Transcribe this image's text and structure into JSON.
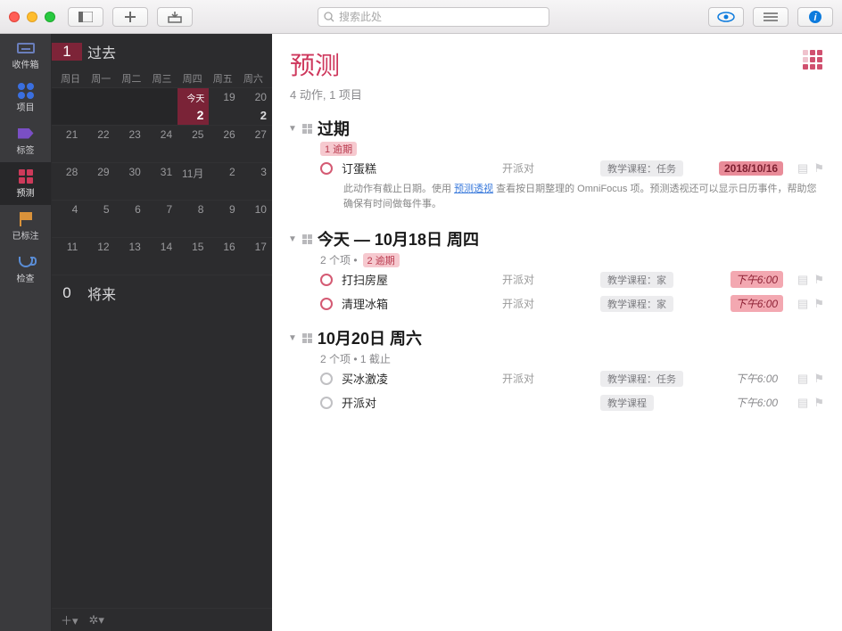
{
  "toolbar": {
    "search_placeholder": "搜索此处"
  },
  "sidebar": {
    "items": [
      {
        "label": "收件箱"
      },
      {
        "label": "项目"
      },
      {
        "label": "标签"
      },
      {
        "label": "预测"
      },
      {
        "label": "已标注"
      },
      {
        "label": "检查"
      }
    ]
  },
  "calendar": {
    "past_badge": "1",
    "past_label": "过去",
    "weekdays": [
      "周日",
      "周一",
      "周二",
      "周三",
      "周四",
      "周五",
      "周六"
    ],
    "today_label": "今天",
    "today_badge": "2",
    "days_row1": [
      "",
      "",
      "",
      "",
      "",
      "19",
      "20"
    ],
    "day20_badge": "2",
    "days_row2": [
      "21",
      "22",
      "23",
      "24",
      "25",
      "26",
      "27"
    ],
    "days_row3": [
      "28",
      "29",
      "30",
      "31",
      "11月",
      "2",
      "3"
    ],
    "days_row4": [
      "4",
      "5",
      "6",
      "7",
      "8",
      "9",
      "10"
    ],
    "days_row5": [
      "11",
      "12",
      "13",
      "14",
      "15",
      "16",
      "17"
    ],
    "future_badge": "0",
    "future_label": "将来"
  },
  "main": {
    "title": "预测",
    "subtitle": "4 动作, 1 项目",
    "sections": [
      {
        "title": "过期",
        "meta_pill": "1 逾期",
        "tasks": [
          {
            "name": "订蛋糕",
            "project": "开派对",
            "tag": "教学课程：任务",
            "due": "2018/10/16",
            "due_style": "redbold",
            "note_pre": "此动作有截止日期。使用 ",
            "note_link": "预测透视",
            "note_post": " 查看按日期整理的 OmniFocus 项。预测透视还可以显示日历事件，帮助您确保有时间做每件事。"
          }
        ]
      },
      {
        "title": "今天 — 10月18日 周四",
        "meta_text": "2 个项 • ",
        "meta_pill": "2 逾期",
        "tasks": [
          {
            "name": "打扫房屋",
            "project": "开派对",
            "tag": "教学课程：家",
            "due": "下午6:00",
            "due_style": "red"
          },
          {
            "name": "清理冰箱",
            "project": "开派对",
            "tag": "教学课程：家",
            "due": "下午6:00",
            "due_style": "red"
          }
        ]
      },
      {
        "title": "10月20日 周六",
        "meta_text": "2 个项 • 1 截止",
        "tasks": [
          {
            "name": "买冰激凌",
            "project": "开派对",
            "tag": "教学课程：任务",
            "due": "下午6:00",
            "due_style": "plain",
            "gray": true
          },
          {
            "name": "开派对",
            "project": "",
            "tag": "教学课程",
            "due": "下午6:00",
            "due_style": "plain",
            "gray": true
          }
        ]
      }
    ]
  }
}
